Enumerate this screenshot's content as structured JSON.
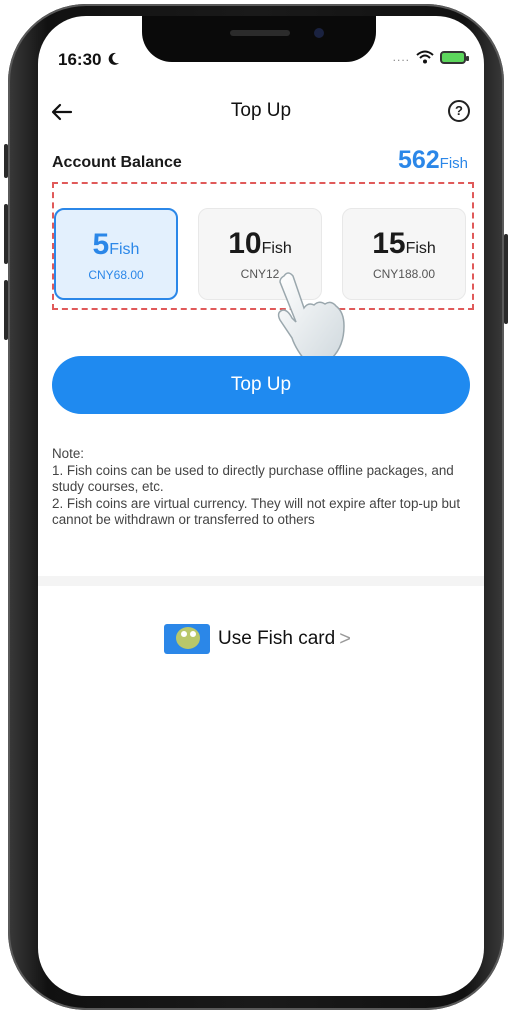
{
  "status_bar": {
    "time": "16:30",
    "signal_dots": "....",
    "wifi_icon": "wifi-icon",
    "battery_icon": "battery-charging-icon"
  },
  "header": {
    "title": "Top Up",
    "back_icon": "arrow-left-icon",
    "help_icon": "question-circle-icon",
    "help_glyph": "?"
  },
  "balance": {
    "label": "Account Balance",
    "value": "562",
    "unit": "Fish"
  },
  "packages": [
    {
      "amount": "5",
      "unit": "Fish",
      "price": "CNY68.00",
      "selected": true
    },
    {
      "amount": "10",
      "unit": "Fish",
      "price": "CNY12",
      "selected": false
    },
    {
      "amount": "15",
      "unit": "Fish",
      "price": "CNY188.00",
      "selected": false
    }
  ],
  "top_up_button": {
    "label": "Top Up"
  },
  "note": {
    "heading": "Note:",
    "lines": [
      "1. Fish coins can be used to directly purchase offline packages, and study courses, etc.",
      "2. Fish coins are virtual currency. They will not expire after top-up but cannot be withdrawn or transferred to others"
    ]
  },
  "fish_card": {
    "label": "Use Fish card",
    "chevron": ">",
    "icon": "fish-card-icon"
  },
  "colors": {
    "accent": "#1f8af0",
    "highlight_frame": "#e05a5a",
    "selected_bg": "#e3f0fd"
  }
}
